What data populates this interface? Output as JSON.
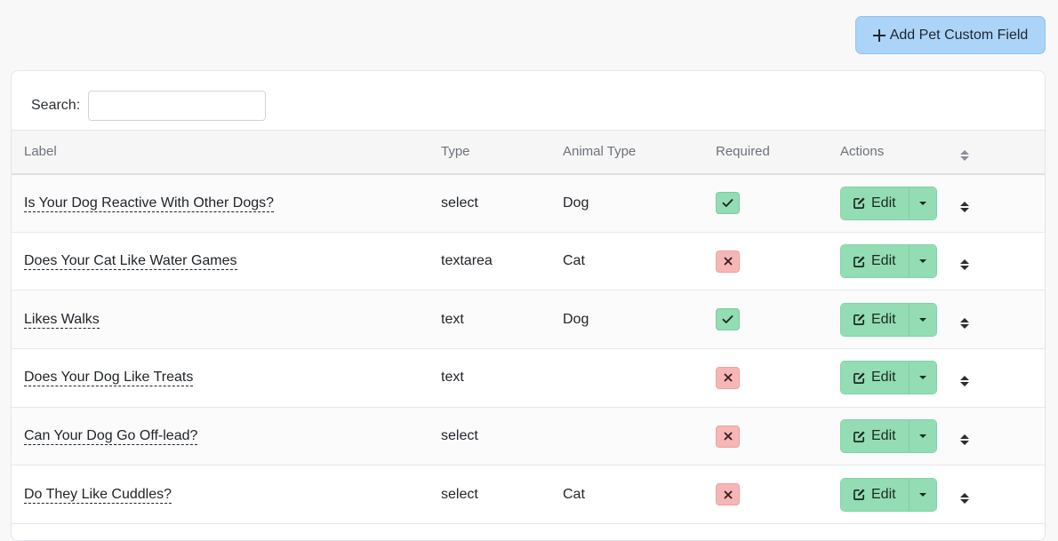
{
  "header": {
    "add_button_label": "Add Pet Custom Field"
  },
  "search": {
    "label": "Search:",
    "value": "",
    "placeholder": ""
  },
  "table": {
    "columns": [
      "Label",
      "Type",
      "Animal Type",
      "Required",
      "Actions"
    ],
    "edit_label": "Edit",
    "rows": [
      {
        "label": "Is Your Dog Reactive With Other Dogs?",
        "type": "select",
        "animal_type": "Dog",
        "required": true
      },
      {
        "label": "Does Your Cat Like Water Games",
        "type": "textarea",
        "animal_type": "Cat",
        "required": false
      },
      {
        "label": "Likes Walks",
        "type": "text",
        "animal_type": "Dog",
        "required": true
      },
      {
        "label": "Does Your Dog Like Treats",
        "type": "text",
        "animal_type": "",
        "required": false
      },
      {
        "label": "Can Your Dog Go Off-lead?",
        "type": "select",
        "animal_type": "",
        "required": false
      },
      {
        "label": "Do They Like Cuddles?",
        "type": "select",
        "animal_type": "Cat",
        "required": false
      }
    ]
  },
  "icons": {
    "add": "plus-icon",
    "edit": "pencil-square-icon",
    "required_yes": "check-icon",
    "required_no": "x-icon",
    "dropdown": "caret-down-icon",
    "reorder": "sort-icon"
  },
  "colors": {
    "add_button_bg": "#acd4f8",
    "edit_button_bg": "#93dcb4",
    "required_yes_bg": "#93dcb4",
    "required_no_bg": "#f6b6b6"
  }
}
